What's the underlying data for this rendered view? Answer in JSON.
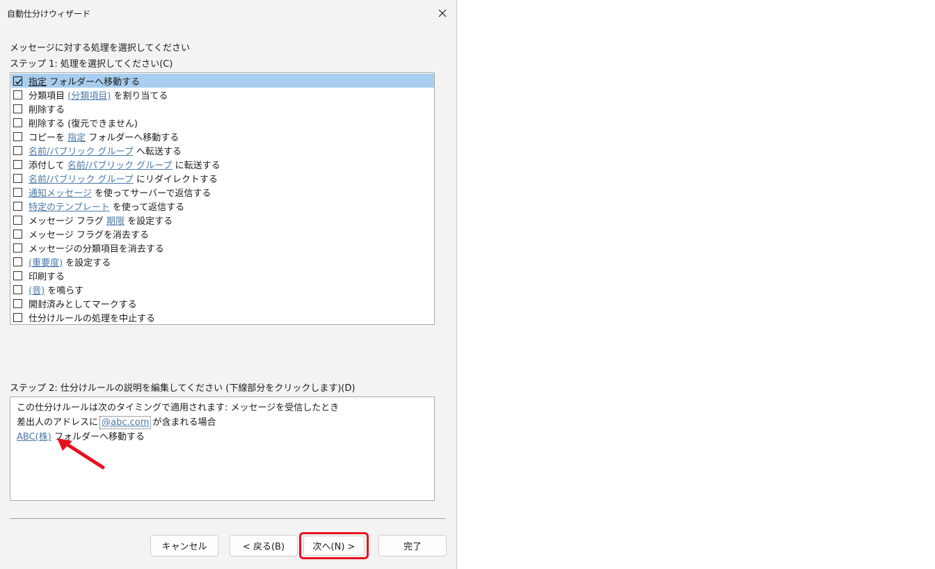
{
  "window": {
    "title": "自動仕分けウィザード"
  },
  "heading": "メッセージに対する処理を選択してください",
  "step1": {
    "label": "ステップ 1: 処理を選択してください(C)",
    "items": [
      {
        "checked": true,
        "selected": true,
        "parts": [
          {
            "link": "指定"
          },
          {
            "text": " フォルダーへ移動する"
          }
        ]
      },
      {
        "checked": false,
        "parts": [
          {
            "text": "分類項目 "
          },
          {
            "link": "(分類項目)"
          },
          {
            "text": " を割り当てる"
          }
        ]
      },
      {
        "checked": false,
        "parts": [
          {
            "text": "削除する"
          }
        ]
      },
      {
        "checked": false,
        "parts": [
          {
            "text": "削除する (復元できません)"
          }
        ]
      },
      {
        "checked": false,
        "parts": [
          {
            "text": "コピーを "
          },
          {
            "link": "指定"
          },
          {
            "text": " フォルダーへ移動する"
          }
        ]
      },
      {
        "checked": false,
        "parts": [
          {
            "link": "名前/パブリック グループ"
          },
          {
            "text": " へ転送する"
          }
        ]
      },
      {
        "checked": false,
        "parts": [
          {
            "text": "添付して "
          },
          {
            "link": "名前/パブリック グループ"
          },
          {
            "text": " に転送する"
          }
        ]
      },
      {
        "checked": false,
        "parts": [
          {
            "link": "名前/パブリック グループ"
          },
          {
            "text": " にリダイレクトする"
          }
        ]
      },
      {
        "checked": false,
        "parts": [
          {
            "link": "通知メッセージ"
          },
          {
            "text": " を使ってサーバーで返信する"
          }
        ]
      },
      {
        "checked": false,
        "parts": [
          {
            "link": "特定のテンプレート"
          },
          {
            "text": " を使って返信する"
          }
        ]
      },
      {
        "checked": false,
        "parts": [
          {
            "text": "メッセージ フラグ "
          },
          {
            "link": "期限"
          },
          {
            "text": " を設定する"
          }
        ]
      },
      {
        "checked": false,
        "parts": [
          {
            "text": "メッセージ フラグを消去する"
          }
        ]
      },
      {
        "checked": false,
        "parts": [
          {
            "text": "メッセージの分類項目を消去する"
          }
        ]
      },
      {
        "checked": false,
        "parts": [
          {
            "link": "(重要度)"
          },
          {
            "text": " を設定する"
          }
        ]
      },
      {
        "checked": false,
        "parts": [
          {
            "text": "印刷する"
          }
        ]
      },
      {
        "checked": false,
        "parts": [
          {
            "link": "(音)"
          },
          {
            "text": " を鳴らす"
          }
        ]
      },
      {
        "checked": false,
        "parts": [
          {
            "text": "開封済みとしてマークする"
          }
        ]
      },
      {
        "checked": false,
        "parts": [
          {
            "text": "仕分けルールの処理を中止する"
          }
        ]
      }
    ]
  },
  "step2": {
    "label": "ステップ 2: 仕分けルールの説明を編集してください (下線部分をクリックします)(D)",
    "line1": "この仕分けルールは次のタイミングで適用されます: メッセージを受信したとき",
    "line2_prefix": "差出人のアドレスに ",
    "line2_link": "@abc.com",
    "line2_suffix": " が含まれる場合",
    "line3_link": "ABC(株)",
    "line3_suffix": " フォルダーへ移動する"
  },
  "buttons": {
    "cancel": "キャンセル",
    "back": "< 戻る(B)",
    "next": "次へ(N) >",
    "finish": "完了"
  },
  "annotations": {
    "highlight_color": "#e8101e",
    "arrow_color": "#e8101e"
  }
}
